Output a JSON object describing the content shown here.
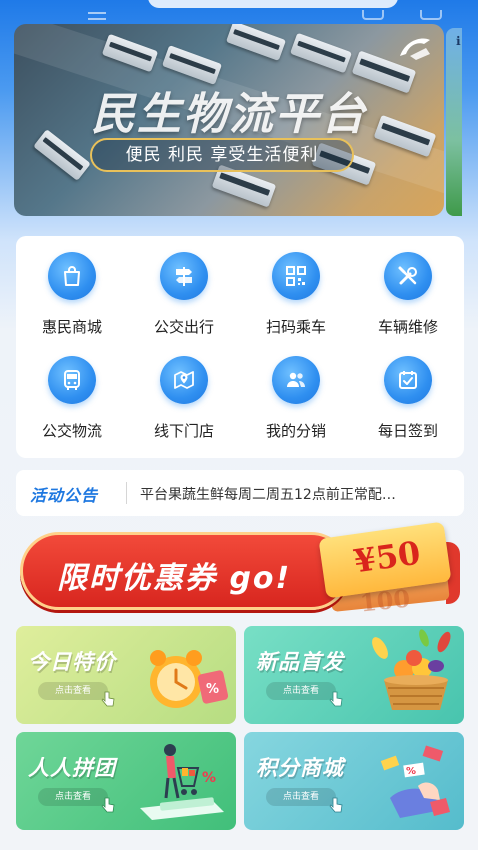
{
  "top_bar": {
    "hint_text": "ℹ"
  },
  "banner": {
    "title": "民生物流平台",
    "slogan": "便民 利民 享受生活便利"
  },
  "nav": {
    "items": [
      {
        "label": "惠民商城",
        "icon": "shopping-bag-icon"
      },
      {
        "label": "公交出行",
        "icon": "signpost-icon"
      },
      {
        "label": "扫码乘车",
        "icon": "qr-code-icon"
      },
      {
        "label": "车辆维修",
        "icon": "wrench-screwdriver-icon"
      },
      {
        "label": "公交物流",
        "icon": "bus-icon"
      },
      {
        "label": "线下门店",
        "icon": "map-pin-icon"
      },
      {
        "label": "我的分销",
        "icon": "users-icon"
      },
      {
        "label": "每日签到",
        "icon": "calendar-check-icon"
      }
    ]
  },
  "notice": {
    "tag": "活动公告",
    "text": "平台果蔬生鲜每周二周五12点前正常配…"
  },
  "coupon": {
    "label": "限时优惠券 go!",
    "amount": "¥50",
    "ghost_amount": "100"
  },
  "tiles": [
    {
      "title": "今日特价",
      "button": "点击查看"
    },
    {
      "title": "新品首发",
      "button": "点击查看"
    },
    {
      "title": "人人拼团",
      "button": "点击查看"
    },
    {
      "title": "积分商城",
      "button": "点击查看"
    }
  ],
  "colors": {
    "primary": "#1f78e0",
    "coupon_red": "#d8261f",
    "tile_yellow_green": "#c8e08a",
    "tile_teal": "#5fd0b8",
    "tile_green": "#58c98a",
    "tile_blue_teal": "#6cc9d4"
  }
}
